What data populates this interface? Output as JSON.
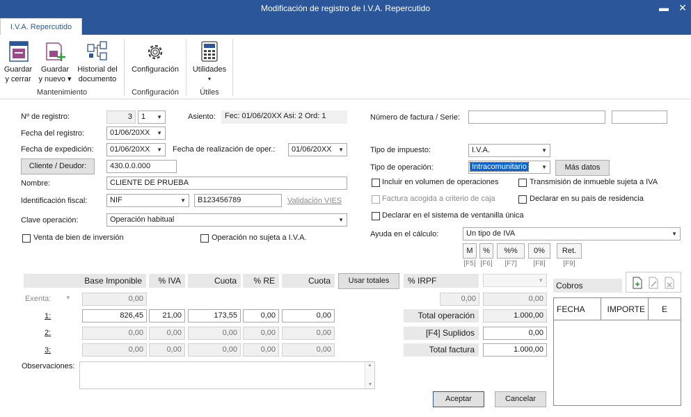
{
  "window": {
    "title": "Modificación de registro de I.V.A. Repercutido",
    "minimize": "▬",
    "close": "✕"
  },
  "ribbon": {
    "tab": "I.V.A. Repercutido",
    "buttons": {
      "save_close": [
        "Guardar",
        "y cerrar"
      ],
      "save_new": [
        "Guardar",
        "y nuevo ▾"
      ],
      "history": [
        "Historial del",
        "documento"
      ],
      "config": "Configuración",
      "utilities": "Utilidades"
    },
    "groups": {
      "maintenance": "Mantenimiento",
      "config": "Configuración",
      "utils": "Útiles"
    }
  },
  "form": {
    "registro_label": "Nº de registro:",
    "registro_num": "3",
    "registro_serie": "1",
    "asiento_label": "Asiento:",
    "asiento_value": "Fec: 01/06/20XX Asi: 2 Ord: 1",
    "fecha_registro_label": "Fecha del registro:",
    "fecha_registro": "01/06/20XX",
    "fecha_expedicion_label": "Fecha de expedición:",
    "fecha_expedicion": "01/06/20XX",
    "fecha_realizacion_label": "Fecha de realización de oper.:",
    "fecha_realizacion": "01/06/20XX",
    "cliente_button": "Cliente / Deudor:",
    "cliente_cuenta": "430.0.0.000",
    "nombre_label": "Nombre:",
    "nombre": "CLIENTE DE PRUEBA",
    "identificacion_label": "Identificación fiscal:",
    "identificacion_tipo": "NIF",
    "identificacion_num": "B123456789",
    "validacion_vies": "Validación VIES",
    "clave_label": "Clave operación:",
    "clave": "Operación habitual",
    "venta_bien": "Venta de bien de inversión",
    "operacion_no_sujeta": "Operación no sujeta a I.V.A.",
    "factura_label": "Número de factura / Serie:",
    "factura_num": "",
    "factura_serie": "",
    "tipo_impuesto_label": "Tipo de impuesto:",
    "tipo_impuesto": "I.V.A.",
    "tipo_operacion_label": "Tipo de operación:",
    "tipo_operacion": "Intracomunitario",
    "mas_datos": "Más datos",
    "incluir_volumen": "Incluir en volumen de operaciones",
    "transmision_inmueble": "Transmisión de inmueble sujeta a IVA",
    "factura_acogida": "Factura acogida a criterio de caja",
    "declarar_pais": "Declarar en su país de residencia",
    "declarar_ventanilla": "Declarar en el sistema de ventanilla única",
    "ayuda_label": "Ayuda en el cálculo:",
    "ayuda_value": "Un tipo de IVA",
    "calc_buttons": [
      "M",
      "%",
      "%%",
      "0%",
      "Ret."
    ],
    "calc_keys": [
      "[F5]",
      "[F6]",
      "[F7]",
      "[F8]",
      "[F9]"
    ]
  },
  "grid": {
    "headers": [
      "Base Imponible",
      "% IVA",
      "Cuota",
      "% RE",
      "Cuota"
    ],
    "usar_totales": "Usar totales",
    "irpf_label": "% IRPF",
    "exenta_label": "Exenta:",
    "exenta_base": "0,00",
    "rows": [
      {
        "label": "1:",
        "base": "826,45",
        "iva": "21,00",
        "cuota": "173,55",
        "re": "0,00",
        "cuota_re": "0,00"
      },
      {
        "label": "2:",
        "base": "0,00",
        "iva": "0,00",
        "cuota": "0,00",
        "re": "0,00",
        "cuota_re": "0,00"
      },
      {
        "label": "3:",
        "base": "0,00",
        "iva": "0,00",
        "cuota": "0,00",
        "re": "0,00",
        "cuota_re": "0,00"
      }
    ],
    "irpf_base": "0,00",
    "irpf_cuota": "0,00",
    "observaciones_label": "Observaciones:",
    "observaciones": ""
  },
  "totals": {
    "total_operacion_label": "Total operación",
    "total_operacion": "1.000,00",
    "suplidos_label": "[F4] Suplidos",
    "suplidos": "0,00",
    "total_factura_label": "Total factura",
    "total_factura": "1.000,00"
  },
  "cobros": {
    "title": "Cobros",
    "columns": [
      "FECHA",
      "IMPORTE",
      "E"
    ]
  },
  "footer": {
    "accept": "Aceptar",
    "cancel": "Cancelar"
  }
}
